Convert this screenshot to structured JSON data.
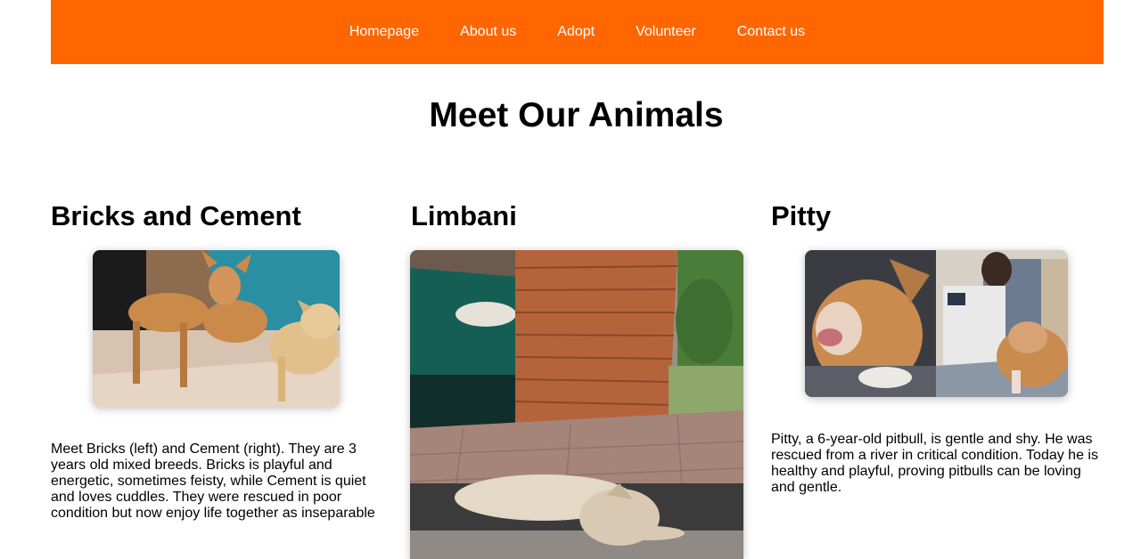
{
  "nav": {
    "items": [
      {
        "label": "Homepage"
      },
      {
        "label": "About us"
      },
      {
        "label": "Adopt"
      },
      {
        "label": "Volunteer"
      },
      {
        "label": "Contact us"
      }
    ]
  },
  "page": {
    "title": "Meet Our Animals"
  },
  "animals": [
    {
      "name": "Bricks and Cement",
      "description": "Meet Bricks (left) and Cement (right). They are 3 years old mixed breeds. Bricks is playful and energetic, sometimes feisty, while Cement is quiet and loves cuddles. They were rescued in poor condition but now enjoy life together as inseparable"
    },
    {
      "name": "Limbani",
      "description": ""
    },
    {
      "name": "Pitty",
      "description": "Pitty, a 6-year-old pitbull, is gentle and shy. He was rescued from a river in critical condition. Today he is healthy and playful, proving pitbulls can be loving and gentle."
    }
  ],
  "colors": {
    "nav_bg": "#ff6600",
    "nav_text": "#ffffff"
  }
}
